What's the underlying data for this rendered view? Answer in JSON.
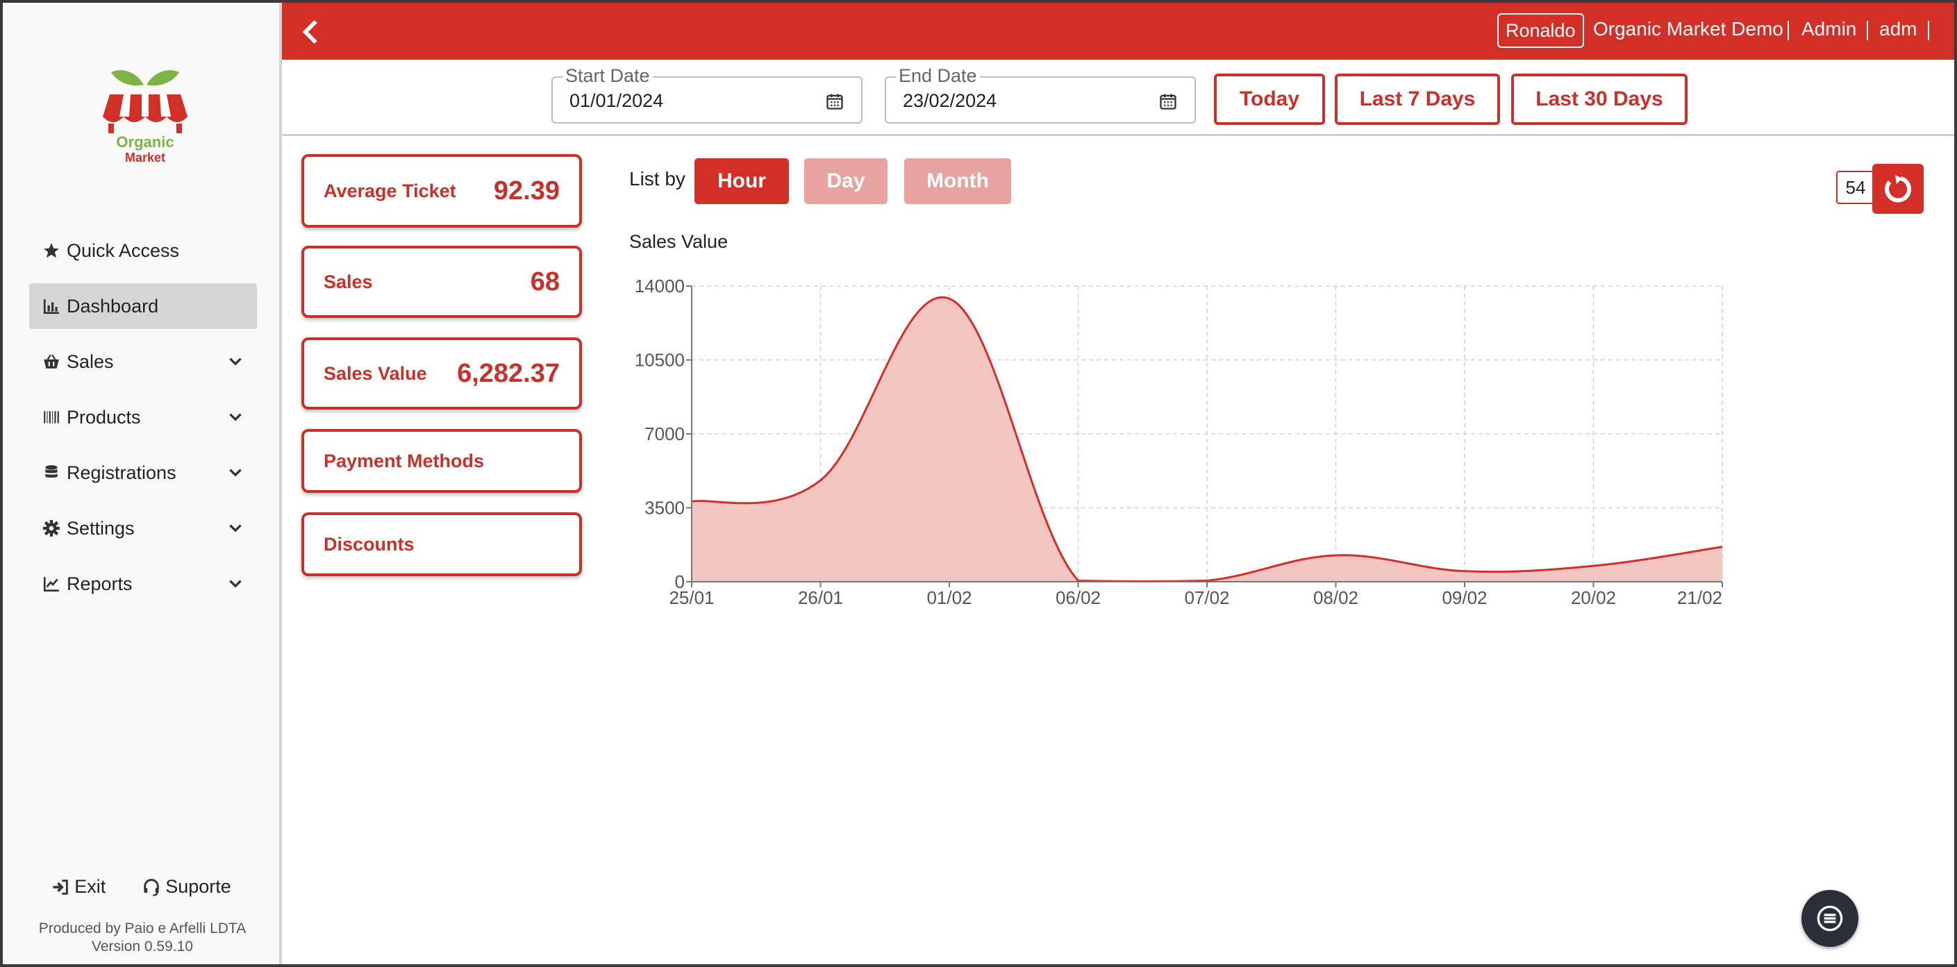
{
  "brand": {
    "logo_line1": "Organic",
    "logo_line2": "Market"
  },
  "sidebar": {
    "items": [
      {
        "label": "Quick Access",
        "icon": "star-icon"
      },
      {
        "label": "Dashboard",
        "icon": "chart-bar-icon",
        "active": true
      },
      {
        "label": "Sales",
        "icon": "basket-icon"
      },
      {
        "label": "Products",
        "icon": "barcode-icon"
      },
      {
        "label": "Registrations",
        "icon": "database-icon"
      },
      {
        "label": "Settings",
        "icon": "gear-icon"
      },
      {
        "label": "Reports",
        "icon": "line-chart-icon"
      }
    ],
    "footer": {
      "exit_label": "Exit",
      "support_label": "Suporte",
      "produced_by": "Produced by Paio e Arfelli LDTA",
      "version": "Version 0.59.10"
    }
  },
  "header": {
    "user": "Ronaldo",
    "company": "Organic Market Demo",
    "role": "Admin",
    "username": "adm"
  },
  "filters": {
    "start_label": "Start Date",
    "start_value": "01/01/2024",
    "end_label": "End Date",
    "end_value": "23/02/2024",
    "today_label": "Today",
    "last7_label": "Last 7 Days",
    "last30_label": "Last 30 Days"
  },
  "metrics": {
    "avg_ticket_label": "Average Ticket",
    "avg_ticket_value": "92.39",
    "sales_label": "Sales",
    "sales_value": "68",
    "sales_value_label": "Sales Value",
    "sales_value_value": "6,282.37",
    "payment_methods_label": "Payment Methods",
    "discounts_label": "Discounts"
  },
  "list_by": {
    "label": "List by",
    "options": [
      "Hour",
      "Day",
      "Month"
    ],
    "selected": "Hour"
  },
  "counter": "54",
  "colors": {
    "accent": "#d22f27",
    "accent_light": "#e8a3a0",
    "area_fill": "#f2c4c2"
  },
  "chart_data": {
    "type": "area",
    "title": "Sales Value",
    "categories": [
      "25/01",
      "26/01",
      "01/02",
      "06/02",
      "07/02",
      "08/02",
      "09/02",
      "20/02",
      "21/02"
    ],
    "series": [
      {
        "values": [
          3800,
          4800,
          13400,
          50,
          50,
          1250,
          500,
          750,
          1650
        ]
      }
    ],
    "yticks": [
      "0",
      "3500",
      "7000",
      "10500",
      "14000"
    ],
    "ylim": [
      0,
      14000
    ],
    "grid": true,
    "curve": "smooth"
  }
}
